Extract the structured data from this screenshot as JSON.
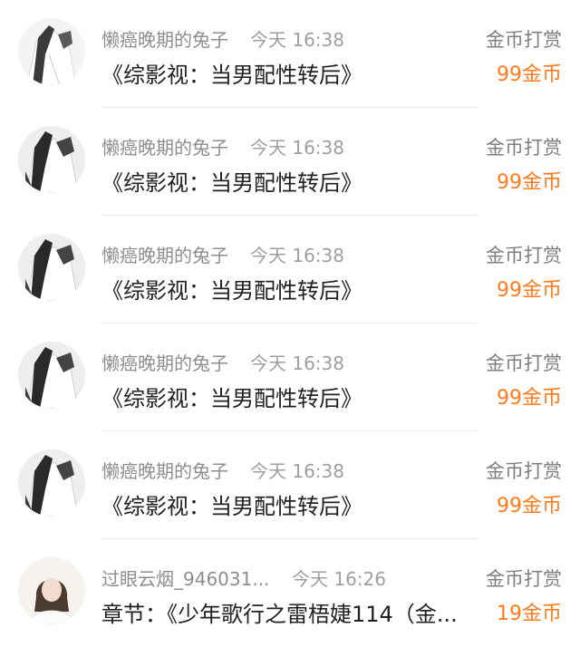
{
  "items": [
    {
      "username": "懒癌晚期的兔子",
      "time": "今天 16:38",
      "title": "《综影视：当男配性转后》",
      "action": "金币打赏",
      "amount": "99金币",
      "avatar_icon": "avatar-girl-white-shirt"
    },
    {
      "username": "懒癌晚期的兔子",
      "time": "今天 16:38",
      "title": "《综影视：当男配性转后》",
      "action": "金币打赏",
      "amount": "99金币",
      "avatar_icon": "avatar-girl-white-shirt"
    },
    {
      "username": "懒癌晚期的兔子",
      "time": "今天 16:38",
      "title": "《综影视：当男配性转后》",
      "action": "金币打赏",
      "amount": "99金币",
      "avatar_icon": "avatar-girl-white-shirt"
    },
    {
      "username": "懒癌晚期的兔子",
      "time": "今天 16:38",
      "title": "《综影视：当男配性转后》",
      "action": "金币打赏",
      "amount": "99金币",
      "avatar_icon": "avatar-girl-white-shirt"
    },
    {
      "username": "懒癌晚期的兔子",
      "time": "今天 16:38",
      "title": "《综影视：当男配性转后》",
      "action": "金币打赏",
      "amount": "99金币",
      "avatar_icon": "avatar-girl-white-shirt"
    },
    {
      "username": "过眼云烟_946031...",
      "time": "今天 16:26",
      "title": "章节：《少年歌行之雷梧婕114（金...",
      "action": "金币打赏",
      "amount": "19金币",
      "avatar_icon": "avatar-girl-smiling"
    }
  ],
  "colors": {
    "amount": "#ff7a1a",
    "muted": "#8e8e8e",
    "title": "#222222"
  }
}
